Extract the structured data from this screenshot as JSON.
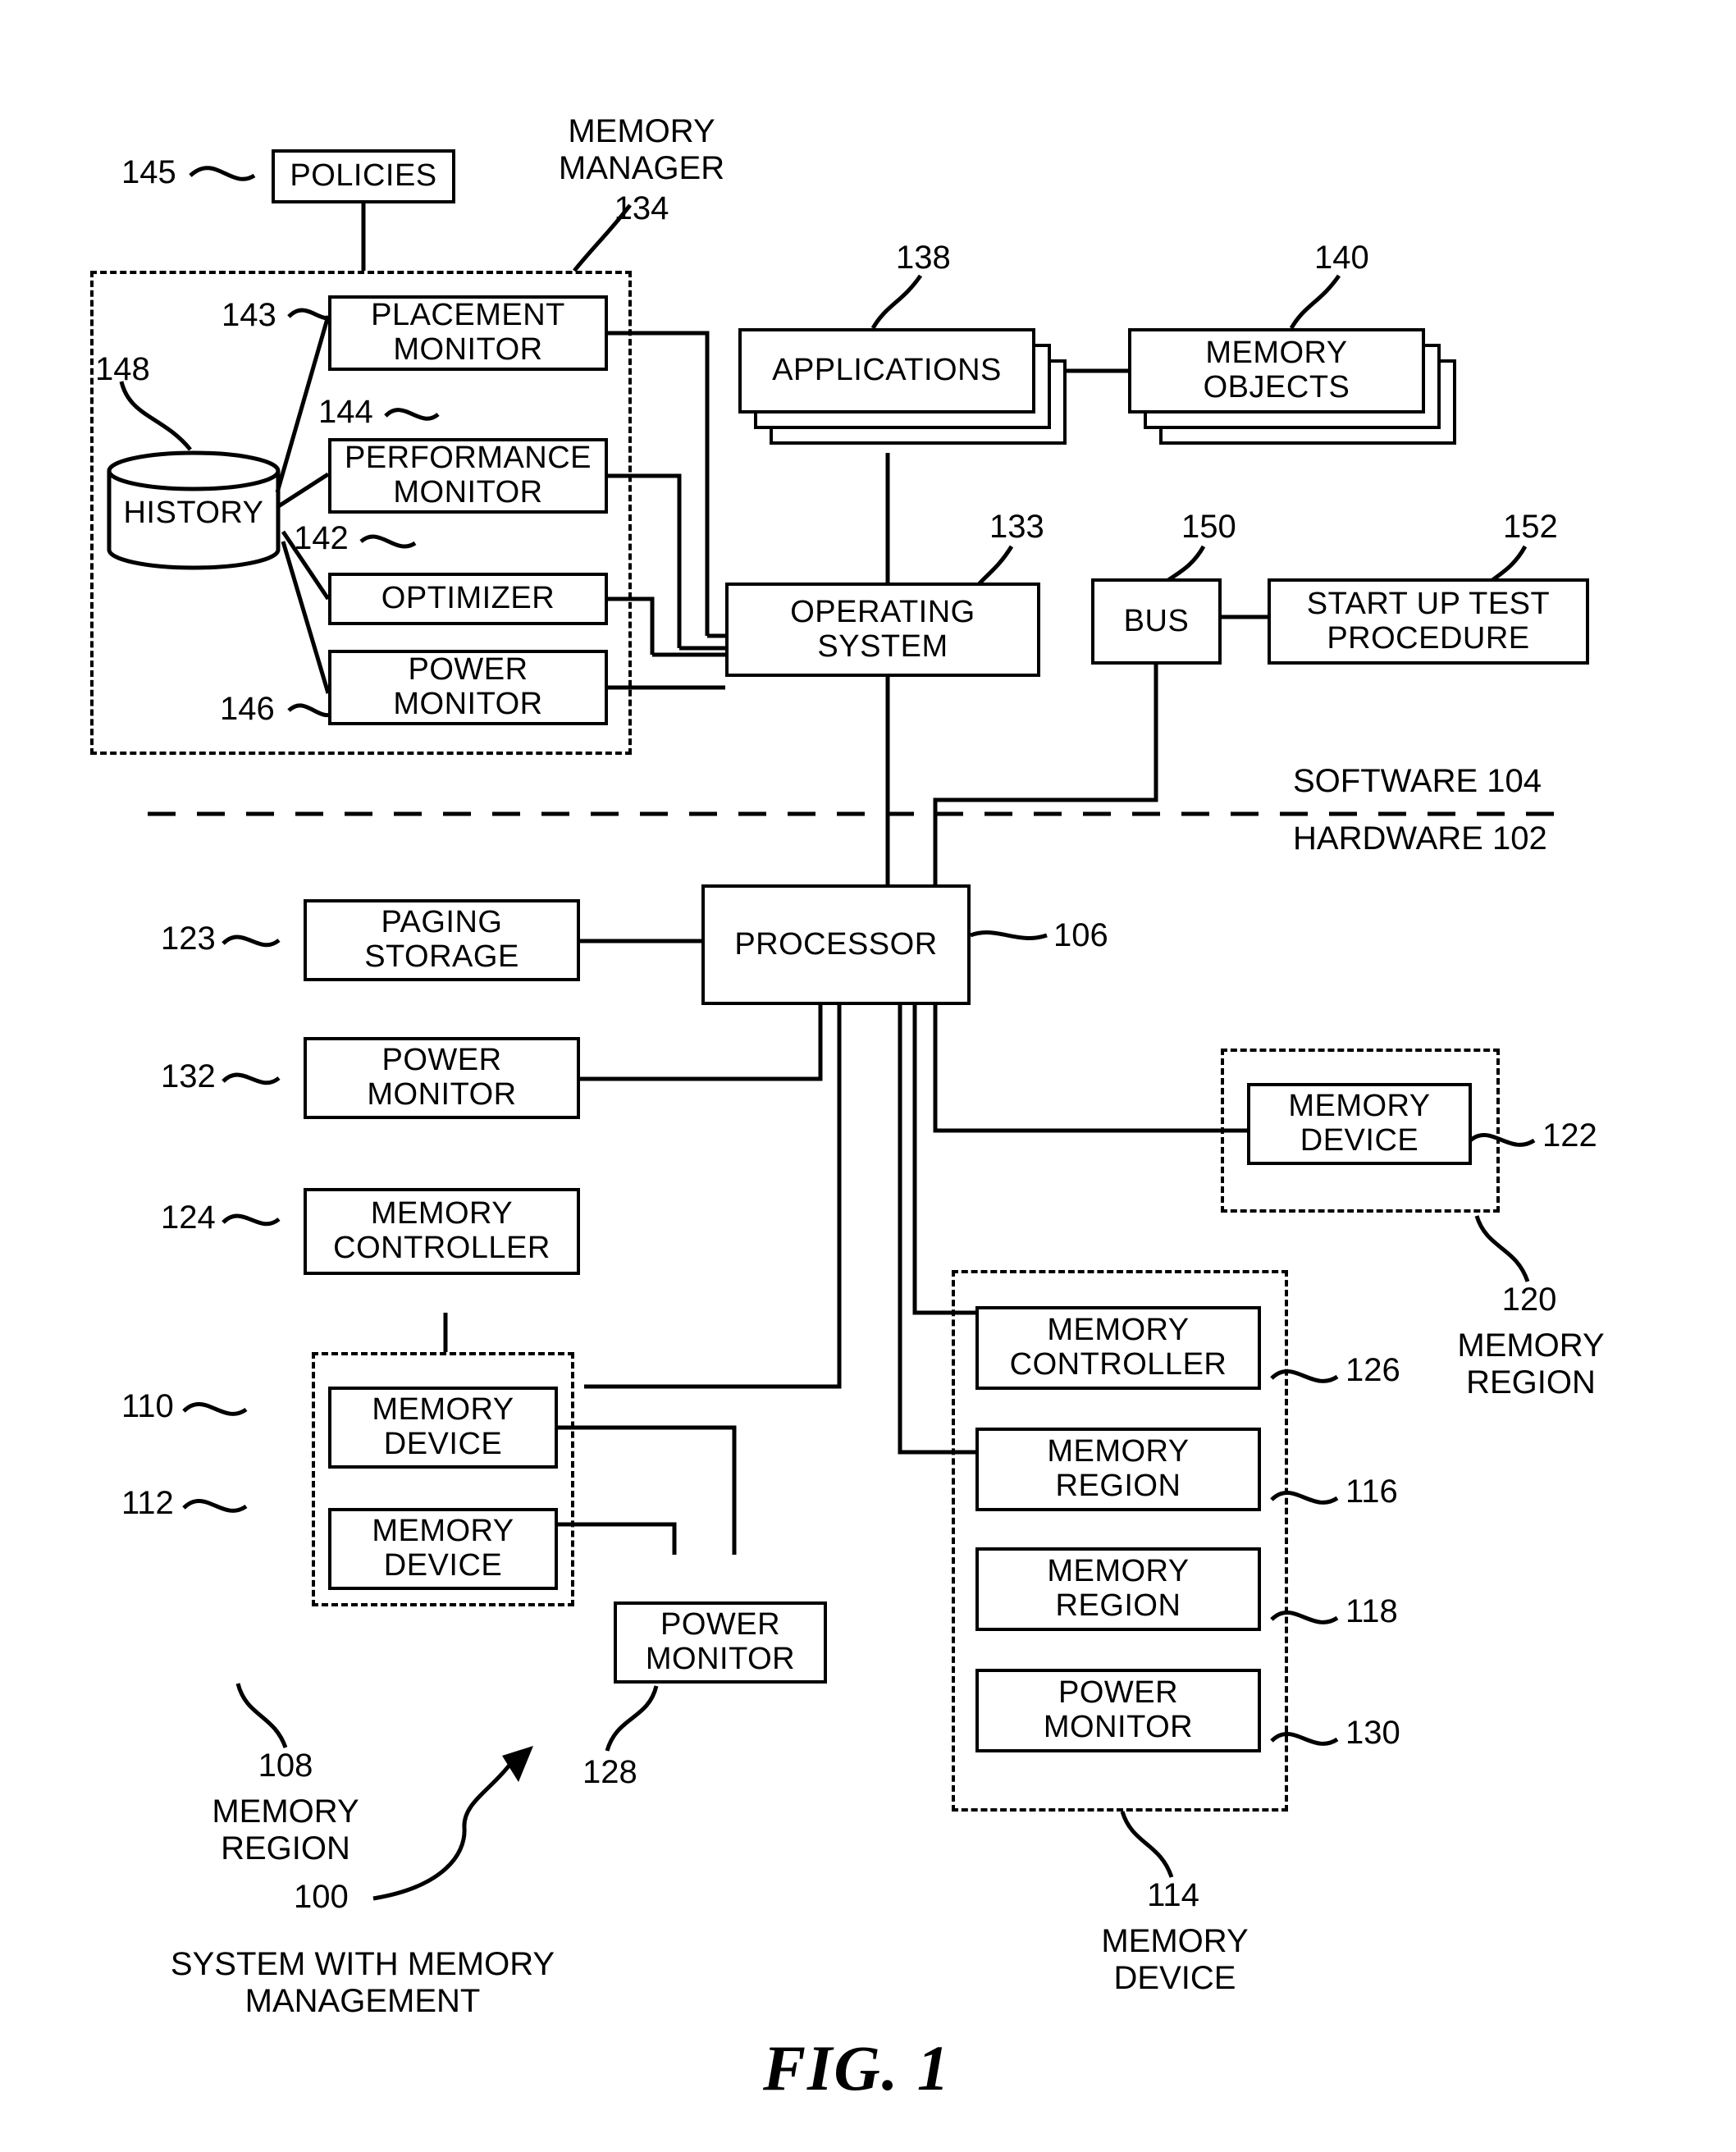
{
  "figure": {
    "label": "FIG. 1",
    "caption_number": "100",
    "caption_text": "SYSTEM WITH MEMORY\nMANAGEMENT"
  },
  "layers": {
    "software": "SOFTWARE 104",
    "hardware": "HARDWARE 102"
  },
  "groups": {
    "memory_manager": {
      "title": "MEMORY\nMANAGER",
      "number": "134"
    },
    "memory_region_108": {
      "number": "108",
      "title": "MEMORY\nREGION"
    },
    "memory_region_120": {
      "number": "120",
      "title": "MEMORY\nREGION"
    },
    "memory_device_114": {
      "number": "114",
      "title": "MEMORY\nDEVICE"
    }
  },
  "blocks": {
    "policies": {
      "label": "POLICIES",
      "number": "145"
    },
    "placement_monitor": {
      "label": "PLACEMENT\nMONITOR",
      "number": "143"
    },
    "performance_monitor": {
      "label": "PERFORMANCE\nMONITOR",
      "number": "144"
    },
    "optimizer": {
      "label": "OPTIMIZER",
      "number": "142"
    },
    "power_monitor_mm": {
      "label": "POWER\nMONITOR",
      "number": "146"
    },
    "history": {
      "label": "HISTORY",
      "number": "148"
    },
    "applications": {
      "label": "APPLICATIONS",
      "number": "138"
    },
    "memory_objects": {
      "label": "MEMORY\nOBJECTS",
      "number": "140"
    },
    "operating_system": {
      "label": "OPERATING\nSYSTEM",
      "number": "133"
    },
    "bus": {
      "label": "BUS",
      "number": "150"
    },
    "start_up_test": {
      "label": "START UP TEST\nPROCEDURE",
      "number": "152"
    },
    "processor": {
      "label": "PROCESSOR",
      "number": "106"
    },
    "paging_storage": {
      "label": "PAGING\nSTORAGE",
      "number": "123"
    },
    "power_monitor_hw": {
      "label": "POWER\nMONITOR",
      "number": "132"
    },
    "memory_controller_124": {
      "label": "MEMORY\nCONTROLLER",
      "number": "124"
    },
    "memory_device_110": {
      "label": "MEMORY\nDEVICE",
      "number": "110"
    },
    "memory_device_112": {
      "label": "MEMORY\nDEVICE",
      "number": "112"
    },
    "power_monitor_128": {
      "label": "POWER\nMONITOR",
      "number": "128"
    },
    "memory_device_122": {
      "label": "MEMORY\nDEVICE",
      "number": "122"
    },
    "memory_controller_126": {
      "label": "MEMORY\nCONTROLLER",
      "number": "126"
    },
    "memory_region_116": {
      "label": "MEMORY\nREGION",
      "number": "116"
    },
    "memory_region_118": {
      "label": "MEMORY\nREGION",
      "number": "118"
    },
    "power_monitor_130": {
      "label": "POWER\nMONITOR",
      "number": "130"
    }
  },
  "colors": {
    "ink": "#000000",
    "paper": "#ffffff"
  }
}
